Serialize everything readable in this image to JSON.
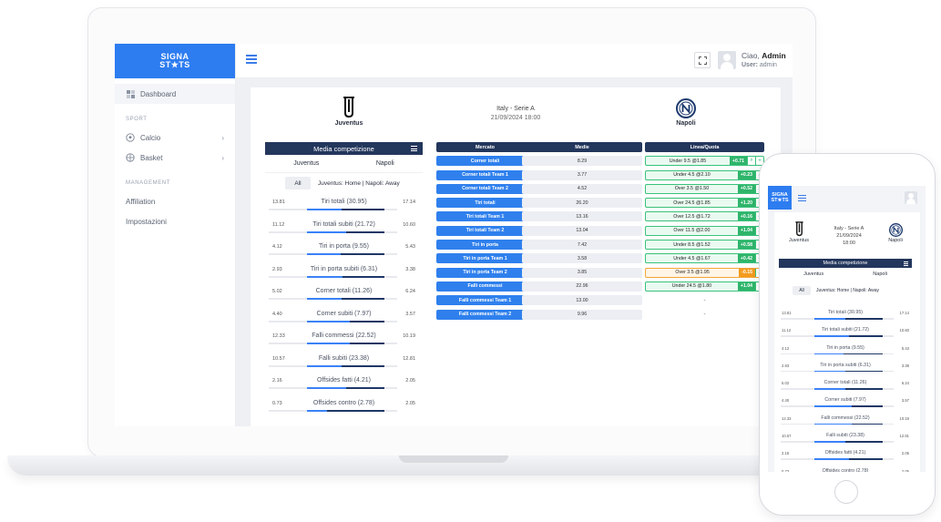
{
  "brand": {
    "logo_line1": "SIGNA",
    "logo_line2": "ST★TS"
  },
  "sidebar": {
    "dashboard": "Dashboard",
    "section_sport": "SPORT",
    "calcio": "Calcio",
    "basket": "Basket",
    "section_management": "MANAGEMENT",
    "affiliation": "Affiliation",
    "impostazioni": "Impostazioni"
  },
  "header": {
    "greeting": "Ciao,",
    "user_name": "Admin",
    "user_label": "User:",
    "user_value": "admin"
  },
  "match": {
    "home_team": "Juventus",
    "away_team": "Napoli",
    "league": "Italy - Serie A",
    "datetime": "21/09/2024 18:00",
    "date": "21/09/2024",
    "time": "18:00"
  },
  "media_card": {
    "title": "Media competizione",
    "team_home": "Juventus",
    "team_away": "Napoli",
    "filter_all": "All",
    "filter_label": "Juventus: Home | Napoli: Away"
  },
  "stats": [
    {
      "name": "Tiri totali (30.95)",
      "home": "13.81",
      "away": "17.14",
      "home_frac": 0.45,
      "away_frac": 0.55
    },
    {
      "name": "Tiri totali subiti (21.72)",
      "home": "11.12",
      "away": "10.60",
      "home_frac": 0.51,
      "away_frac": 0.49
    },
    {
      "name": "Tiri in porta (9.55)",
      "home": "4.12",
      "away": "5.43",
      "home_frac": 0.43,
      "away_frac": 0.57
    },
    {
      "name": "Tiri in porta subiti (6.31)",
      "home": "2.93",
      "away": "3.38",
      "home_frac": 0.46,
      "away_frac": 0.54
    },
    {
      "name": "Corner totali (11.26)",
      "home": "5.02",
      "away": "6.24",
      "home_frac": 0.45,
      "away_frac": 0.55
    },
    {
      "name": "Corner subiti (7.97)",
      "home": "4.40",
      "away": "3.57",
      "home_frac": 0.55,
      "away_frac": 0.45
    },
    {
      "name": "Falli commessi (22.52)",
      "home": "12.33",
      "away": "10.19",
      "home_frac": 0.55,
      "away_frac": 0.45
    },
    {
      "name": "Falli subiti (23.38)",
      "home": "10.57",
      "away": "12.81",
      "home_frac": 0.45,
      "away_frac": 0.55
    },
    {
      "name": "Offsides fatti (4.21)",
      "home": "2.16",
      "away": "2.05",
      "home_frac": 0.51,
      "away_frac": 0.49
    },
    {
      "name": "Offsides contro (2.78)",
      "home": "0.73",
      "away": "2.05",
      "home_frac": 0.26,
      "away_frac": 0.74
    }
  ],
  "markets_header": {
    "mercato": "Mercato",
    "medie": "Medie",
    "linea": "Linea/Quota"
  },
  "markets": [
    {
      "mercato": "Corner totali",
      "media": "8.29",
      "linea": "Under 9.5 @1.85",
      "delta": "+0.71",
      "style": "green"
    },
    {
      "mercato": "Corner totali Team 1",
      "media": "3.77",
      "linea": "Under 4.5 @2.10",
      "delta": "+0.23",
      "style": "green"
    },
    {
      "mercato": "Corner totali Team 2",
      "media": "4.52",
      "linea": "Over 3.5 @1.50",
      "delta": "+0.52",
      "style": "green"
    },
    {
      "mercato": "Tiri totali",
      "media": "26.20",
      "linea": "Over 24.5 @1.85",
      "delta": "+1.20",
      "style": "green"
    },
    {
      "mercato": "Tiri totali Team 1",
      "media": "13.16",
      "linea": "Over 12.5 @1.72",
      "delta": "+0.16",
      "style": "green"
    },
    {
      "mercato": "Tiri totali Team 2",
      "media": "13.04",
      "linea": "Over 11.5 @2.00",
      "delta": "+1.04",
      "style": "green"
    },
    {
      "mercato": "Tiri in porta",
      "media": "7.42",
      "linea": "Under 8.5 @1.52",
      "delta": "+0.58",
      "style": "green"
    },
    {
      "mercato": "Tiri in porta Team 1",
      "media": "3.58",
      "linea": "Under 4.5 @1.67",
      "delta": "+0.42",
      "style": "green"
    },
    {
      "mercato": "Tiri in porta Team 2",
      "media": "3.85",
      "linea": "Over 3.5 @1.95",
      "delta": "-0.15",
      "style": "orange"
    },
    {
      "mercato": "Falli commessi",
      "media": "22.96",
      "linea": "Under 24.5 @1.80",
      "delta": "+1.04",
      "style": "green"
    },
    {
      "mercato": "Falli commessi Team 1",
      "media": "13.00",
      "linea": "-",
      "delta": "",
      "style": "empty"
    },
    {
      "mercato": "Falli commessi Team 2",
      "media": "9.96",
      "linea": "-",
      "delta": "",
      "style": "empty"
    }
  ],
  "colors": {
    "primary": "#2d7cf0",
    "navy": "#23365c",
    "green": "#2fb56b",
    "orange": "#f39b1f"
  },
  "icons": [
    "dashboard-icon",
    "football-icon",
    "basketball-icon",
    "hamburger-icon",
    "fullscreen-icon",
    "avatar-icon",
    "juventus-logo",
    "napoli-logo",
    "search-icon",
    "plus-icon"
  ]
}
